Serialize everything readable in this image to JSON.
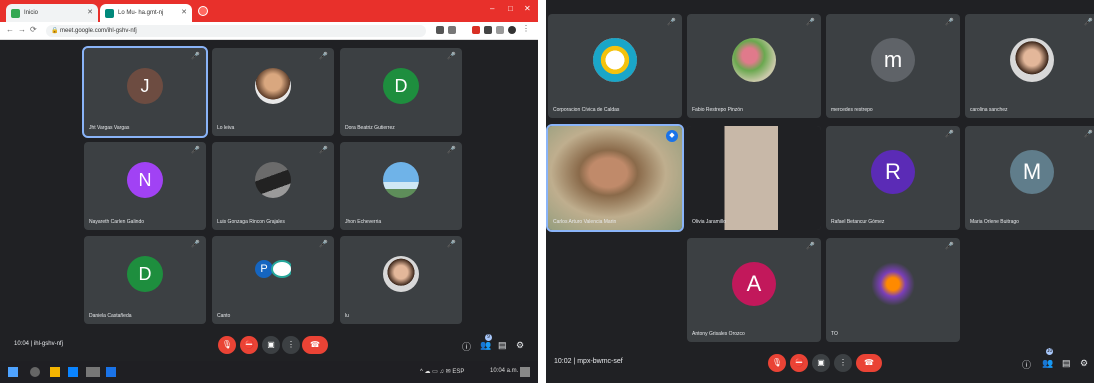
{
  "left": {
    "browser": {
      "tabs": [
        {
          "label": "Inicio"
        },
        {
          "label": "Lo Mu- ha.gmt-nj"
        }
      ],
      "url": "meet.google.com/ihl-gshv-nfj"
    },
    "participants": [
      {
        "initial": "J",
        "name": "Jht Vargas Vargas",
        "color": "#6d4c41",
        "selected": true
      },
      {
        "initial": "",
        "name": "Lo leiva",
        "photo": "woman-glasses"
      },
      {
        "initial": "D",
        "name": "Dora Beatriz Gutierrez",
        "color": "#1e8e3e"
      },
      {
        "initial": "N",
        "name": "Nayareth Carlen Galindo",
        "color": "#a142f4"
      },
      {
        "initial": "",
        "name": "Luis Gonzaga Rincon Grajales",
        "photo": "man-desk"
      },
      {
        "initial": "",
        "name": "Jhon Echeverria",
        "photo": "landscape"
      },
      {
        "initial": "D",
        "name": "Daniela Castañeda",
        "color": "#1e8e3e"
      },
      {
        "initial": "",
        "name": "Canto",
        "photo": "logo-p"
      },
      {
        "initial": "",
        "name": "lu",
        "photo": "woman-hair"
      }
    ],
    "meeting_code": "10:04 | ihl-gshv-nfj",
    "tray_time": "10:04 a.m."
  },
  "right": {
    "participants": [
      {
        "initial": "",
        "name": "Corporacion Cívica de Caldas",
        "photo": "logo-circle"
      },
      {
        "initial": "",
        "name": "Fabio Restrepo Pinzón",
        "photo": "flowers"
      },
      {
        "initial": "m",
        "name": "mercedes restrepo",
        "color": "#5f6368"
      },
      {
        "initial": "",
        "name": "carolina sanchez",
        "photo": "woman-hair"
      },
      {
        "initial": "",
        "name": "Carlos Arturo Valencia Marin",
        "photo": "man-video",
        "selected": true
      },
      {
        "initial": "",
        "name": "Olivia Jaramillo",
        "photo": "woman-video"
      },
      {
        "initial": "R",
        "name": "Rafael Betancur Gómez",
        "color": "#5b2bb6"
      },
      {
        "initial": "M",
        "name": "Maria Orlene Buitrago",
        "color": "#607d8b"
      },
      {
        "initial": "A",
        "name": "Antony Grisales Orozco",
        "color": "#c2185b"
      },
      {
        "initial": "",
        "name": "TO",
        "photo": "logo-color"
      }
    ],
    "meeting_code": "10:02 | mpx-bwmc-sef"
  },
  "colors": {
    "accent_blue": "#8ab4f8",
    "end_call": "#ea4335",
    "tile_bg": "#3c4043",
    "bg": "#202124"
  },
  "icons": [
    "mic-off-icon",
    "cam-off-icon",
    "present-icon",
    "more-icon",
    "end-call-icon",
    "info-icon",
    "people-icon",
    "chat-icon",
    "activities-icon"
  ]
}
